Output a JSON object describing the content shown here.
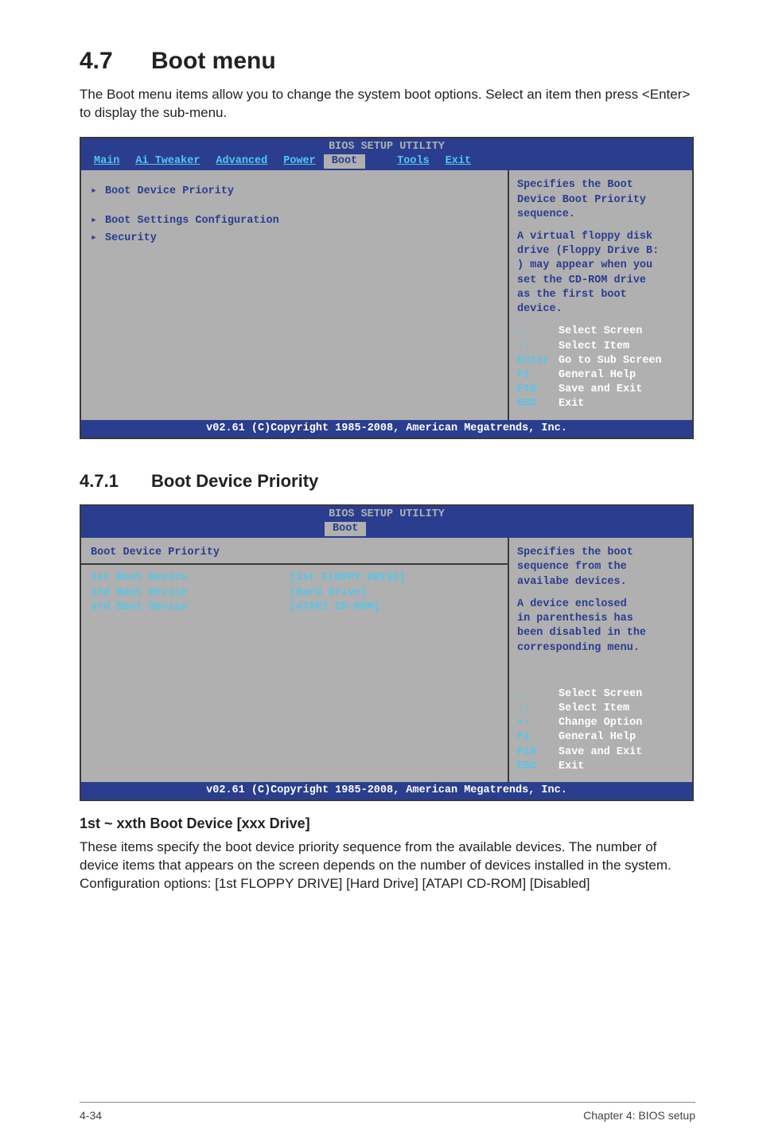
{
  "section": {
    "number": "4.7",
    "title": "Boot menu",
    "intro": "The Boot menu items allow you to change the system boot options. Select an item then press <Enter> to display the sub-menu."
  },
  "bios1": {
    "title": "BIOS SETUP UTILITY",
    "tabs": [
      "Main",
      "Ai Tweaker",
      "Advanced",
      "Power",
      "Boot",
      "Tools",
      "Exit"
    ],
    "active_tab": "Boot",
    "left_items": [
      "Boot Device Priority",
      "Boot Settings Configuration",
      "Security"
    ],
    "right_help_top": [
      "Specifies the Boot",
      "Device Boot Priority",
      "sequence."
    ],
    "right_help_mid": [
      "A virtual floppy disk",
      "drive (Floppy Drive B:",
      ") may appear when you",
      "set the CD-ROM drive",
      "as the first boot",
      "device."
    ],
    "legend": [
      {
        "key": "←→",
        "label": "Select Screen"
      },
      {
        "key": "↑↓",
        "label": "Select Item"
      },
      {
        "key": "Enter",
        "label": "Go to Sub Screen"
      },
      {
        "key": "F1",
        "label": "General Help"
      },
      {
        "key": "F10",
        "label": "Save and Exit"
      },
      {
        "key": "ESC",
        "label": "Exit"
      }
    ],
    "footer": "v02.61 (C)Copyright 1985-2008, American Megatrends, Inc."
  },
  "subsection": {
    "number": "4.7.1",
    "title": "Boot Device Priority"
  },
  "bios2": {
    "title": "BIOS SETUP UTILITY",
    "active_tab": "Boot",
    "heading": "Boot Device Priority",
    "rows": [
      {
        "k": "1st Boot Device",
        "v": "[1st FLOPPY DRIVE]"
      },
      {
        "k": "2nd Boot Device",
        "v": "[Hard Drive]"
      },
      {
        "k": "3rd Boot Device",
        "v": "[ATAPI CD-ROM]"
      }
    ],
    "right_help_top": [
      "Specifies the boot",
      "sequence from the",
      "availabe devices."
    ],
    "right_help_mid": [
      "A device enclosed",
      "in parenthesis has",
      "been disabled in the",
      "corresponding menu."
    ],
    "legend": [
      {
        "key": "←→",
        "label": "Select Screen"
      },
      {
        "key": "↑↓",
        "label": "Select Item"
      },
      {
        "key": "+-",
        "label": "Change Option"
      },
      {
        "key": "F1",
        "label": "General Help"
      },
      {
        "key": "F10",
        "label": "Save and Exit"
      },
      {
        "key": "ESC",
        "label": "Exit"
      }
    ],
    "footer": "v02.61 (C)Copyright 1985-2008, American Megatrends, Inc."
  },
  "field": {
    "title": "1st ~ xxth Boot Device [xxx Drive]",
    "text": "These items specify the boot device priority sequence from the available devices. The number of device items that appears on the screen depends on the number of devices installed in the system. Configuration options: [1st FLOPPY DRIVE] [Hard Drive] [ATAPI CD-ROM] [Disabled]"
  },
  "footer": {
    "left": "4-34",
    "right": "Chapter 4: BIOS setup"
  }
}
